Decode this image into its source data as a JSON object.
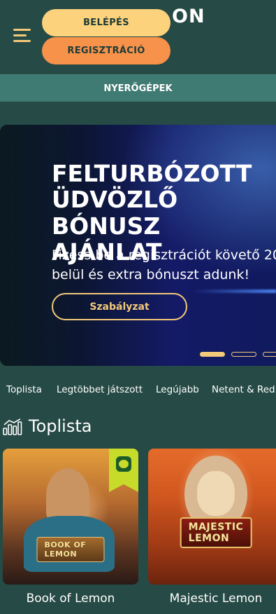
{
  "header": {
    "logo_text": "ON",
    "login_label": "BELÉPÉS",
    "register_label": "REGISZTRÁCIÓ"
  },
  "subnav": {
    "label": "NYERŐGÉPEK"
  },
  "banner": {
    "title": "FELTURBÓZOTT\nÜDVÖZLŐ BÓNUSZ\nAJÁNLAT",
    "subtitle": "Fizess be a regisztrációt követő 20\nbelül és extra bónuszt adunk!",
    "button_label": "Szabályzat",
    "carousel": {
      "total_visible_dots": 3,
      "active_index": 0
    }
  },
  "tabs": [
    "Toplista",
    "Legtöbbet játszott",
    "Legújabb",
    "Netent & Red"
  ],
  "section": {
    "title": "Toplista",
    "icon": "bar-chart-icon"
  },
  "games": [
    {
      "name": "Book of Lemon",
      "logo": "BOOK OF LEMON",
      "badge": "lemon-badge-icon"
    },
    {
      "name": "Majestic Lemon",
      "logo": "MAJESTIC LEMON"
    }
  ],
  "colors": {
    "background": "#264a45",
    "subnav": "#3f7a73",
    "login": "#fcd27c",
    "register": "#f7924b",
    "accent": "#f3c97a"
  }
}
